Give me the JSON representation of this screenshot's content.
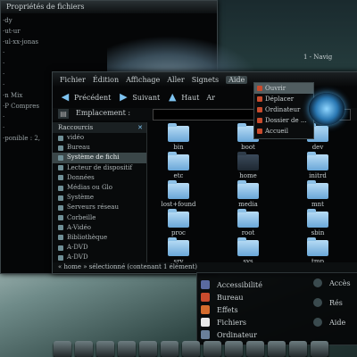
{
  "back_window": {
    "title": "Propriétés de fichiers",
    "lines": [
      "·dy",
      "·ut·ur",
      "·ul·xx-jonas",
      "·",
      "·",
      "·",
      "·",
      "·n Mix",
      "·P Compres",
      "·",
      "·",
      "·ponible : 2,"
    ]
  },
  "right_text": "1 - Navig",
  "menubar": [
    "Fichier",
    "Édition",
    "Affichage",
    "Aller",
    "Signets",
    "Aide"
  ],
  "toolbar": {
    "back": "Précédent",
    "forward": "Suivant",
    "up": "Haut",
    "more": "Ar"
  },
  "address": {
    "label": "Emplacement :",
    "value": ""
  },
  "places": {
    "header": "Raccourcis",
    "items": [
      "vidéo",
      "Bureau",
      "Système de fichi",
      "Lecteur de dispositif",
      "Données",
      "Médias ou Glo",
      "Système",
      "Serveurs réseau",
      "Corbeille",
      "A-Vidéo",
      "Bibliothèque",
      "A-DVD",
      "A-DVD"
    ],
    "selected_index": 2
  },
  "files": [
    {
      "name": "bin",
      "dark": false
    },
    {
      "name": "boot",
      "dark": false
    },
    {
      "name": "dev",
      "dark": false
    },
    {
      "name": "etc",
      "dark": false
    },
    {
      "name": "home",
      "dark": true
    },
    {
      "name": "initrd",
      "dark": false
    },
    {
      "name": "lost+found",
      "dark": false
    },
    {
      "name": "media",
      "dark": false
    },
    {
      "name": "mnt",
      "dark": false
    },
    {
      "name": "proc",
      "dark": false
    },
    {
      "name": "root",
      "dark": false
    },
    {
      "name": "sbin",
      "dark": false
    },
    {
      "name": "srv",
      "dark": false
    },
    {
      "name": "sys",
      "dark": false
    },
    {
      "name": "tmp",
      "dark": false
    }
  ],
  "status": "« home » sélectionné (contenant 1 élément)",
  "dropdown": [
    "Ouvrir",
    "Déplacer",
    "Ordinateur",
    "Dossier de ...",
    "Accueil"
  ],
  "start_menu": {
    "items": [
      {
        "label": "Accessibilité",
        "color": "#5a6aa0"
      },
      {
        "label": "Bureau",
        "color": "#c84b2d"
      },
      {
        "label": "Effets",
        "color": "#d46c2e"
      },
      {
        "label": "Fichiers",
        "color": "#e8e8e8"
      },
      {
        "label": "Ordinateur",
        "color": "#6a7f9a"
      }
    ],
    "side_items": [
      "Accès",
      "Rés",
      "Aide"
    ]
  }
}
